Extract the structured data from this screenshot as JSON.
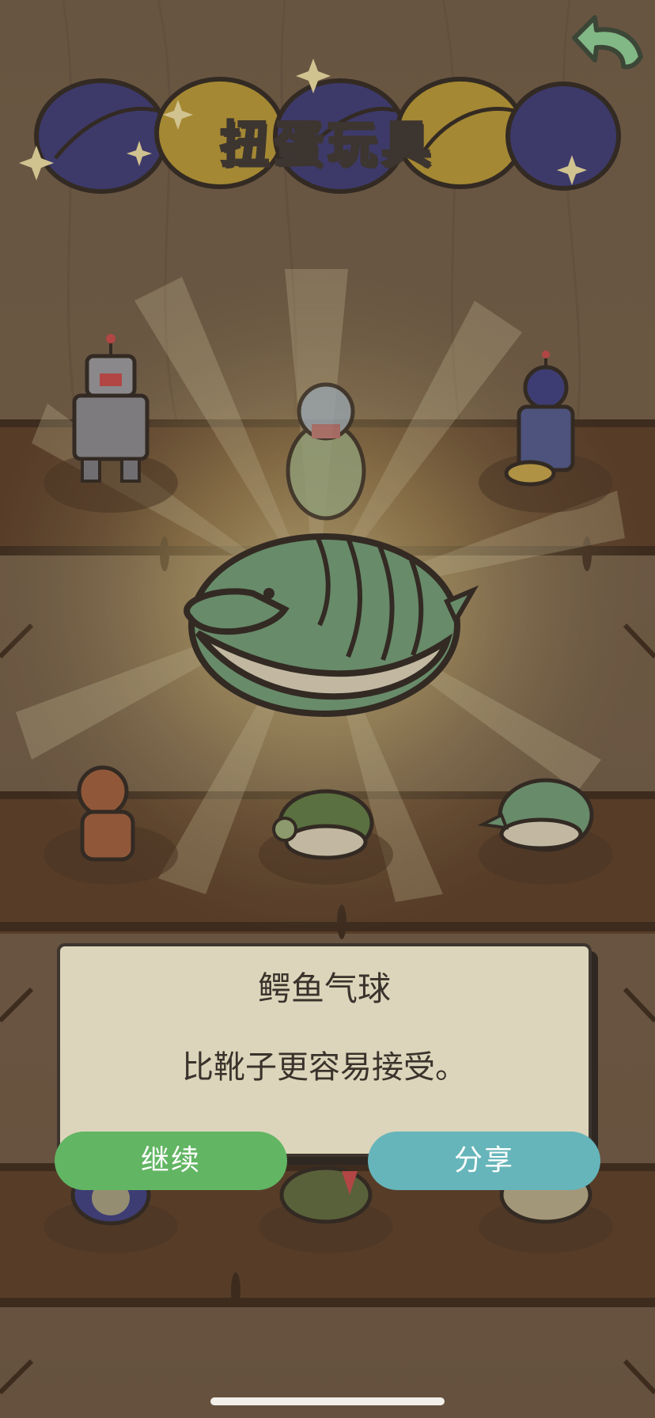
{
  "header": {
    "title": "扭蛋玩具",
    "back_icon": "curved-back-arrow-icon"
  },
  "featured_item": {
    "name": "鳄鱼气球",
    "description": "比靴子更容易接受。",
    "icon": "crocodile-balloon-icon"
  },
  "buttons": {
    "continue_label": "继续",
    "share_label": "分享"
  },
  "shelf_items": [
    {
      "icon": "tin-robot-icon"
    },
    {
      "icon": "green-robot-icon"
    },
    {
      "icon": "drummer-toy-icon"
    },
    {
      "icon": "wooden-doll-icon"
    },
    {
      "icon": "turtle-toy-icon"
    },
    {
      "icon": "crocodile-toy-icon"
    },
    {
      "icon": "blue-creature-icon"
    },
    {
      "icon": "bird-toy-icon"
    },
    {
      "icon": "beige-creature-icon"
    }
  ],
  "colors": {
    "wood_background": "#735f48",
    "shelf": "#5b3f28",
    "dialog_background": "#ddd5bb",
    "continue_button": "#62b563",
    "share_button": "#66b5ba",
    "capsule_blue": "#3b3b78",
    "capsule_yellow": "#b99a35",
    "croc_green": "#6f9e78"
  }
}
